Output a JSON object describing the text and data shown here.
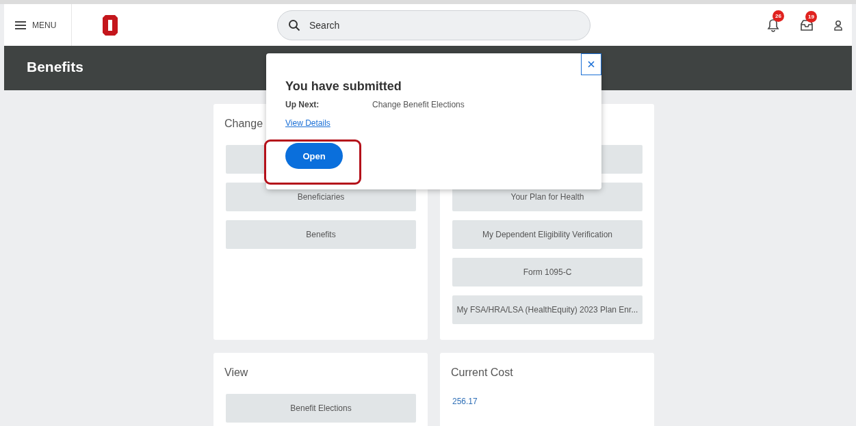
{
  "header": {
    "menu_label": "MENU",
    "search": {
      "placeholder": "Search"
    },
    "notifications_badge": "26",
    "inbox_badge": "19"
  },
  "page_title": "Benefits",
  "cards": [
    {
      "title": "Change",
      "items": [
        {
          "kind": "covered"
        },
        {
          "kind": "button",
          "label": "Beneficiaries"
        },
        {
          "kind": "button",
          "label": "Benefits"
        }
      ]
    },
    {
      "items": [
        {
          "kind": "covered"
        },
        {
          "kind": "button",
          "label": "Your Plan for Health"
        },
        {
          "kind": "button",
          "label": "My Dependent Eligibility Verification"
        },
        {
          "kind": "button",
          "label": "Form 1095-C"
        },
        {
          "kind": "button",
          "label": "My FSA/HRA/LSA (HealthEquity) 2023 Plan Enr..."
        }
      ]
    },
    {
      "title": "View",
      "items": [
        {
          "kind": "button",
          "label": "Benefit Elections"
        }
      ]
    },
    {
      "title": "Current Cost",
      "items": [
        {
          "kind": "link",
          "label": "256.17"
        }
      ]
    }
  ],
  "popup": {
    "title": "You have submitted",
    "up_next_label": "Up Next:",
    "up_next_value": "Change Benefit Elections",
    "link": "View Details",
    "button": "Open",
    "highlighted": true
  }
}
